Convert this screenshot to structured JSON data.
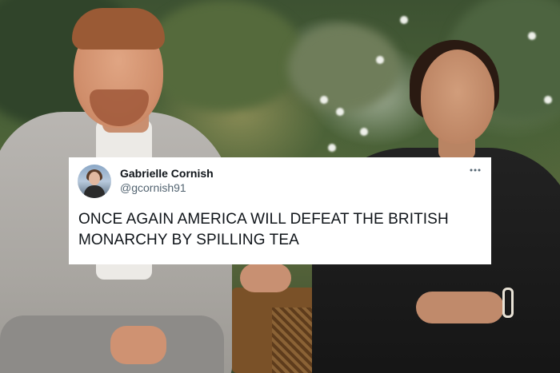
{
  "tweet": {
    "name": "Gabrielle Cornish",
    "handle": "@gcornish91",
    "more_icon": "…",
    "text": "ONCE AGAIN AMERICA WILL DEFEAT THE BRITISH MONARCHY BY SPILLING TEA"
  },
  "icons": {
    "avatar": "profile-photo",
    "more": "more-horizontal-icon"
  }
}
